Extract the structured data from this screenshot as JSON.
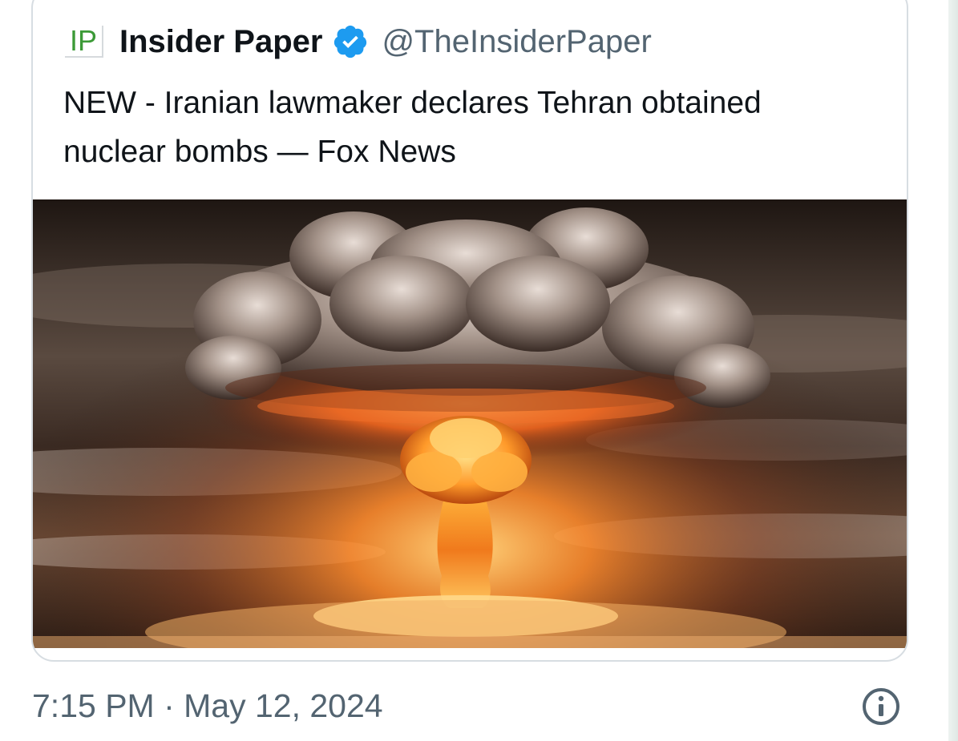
{
  "tweet": {
    "logo_text": "IP",
    "author_name": "Insider Paper",
    "handle": "@TheInsiderPaper",
    "headline": "NEW - Iranian lawmaker declares Tehran obtained nuclear bombs — Fox News",
    "timestamp": "7:15 PM · May 12, 2024"
  },
  "icons": {
    "verified": "verified-badge-icon",
    "info": "info-icon"
  },
  "colors": {
    "verified_blue": "#1d9bf0",
    "text_primary": "#0f1419",
    "text_secondary": "#536471",
    "logo_green": "#3c9a37"
  }
}
